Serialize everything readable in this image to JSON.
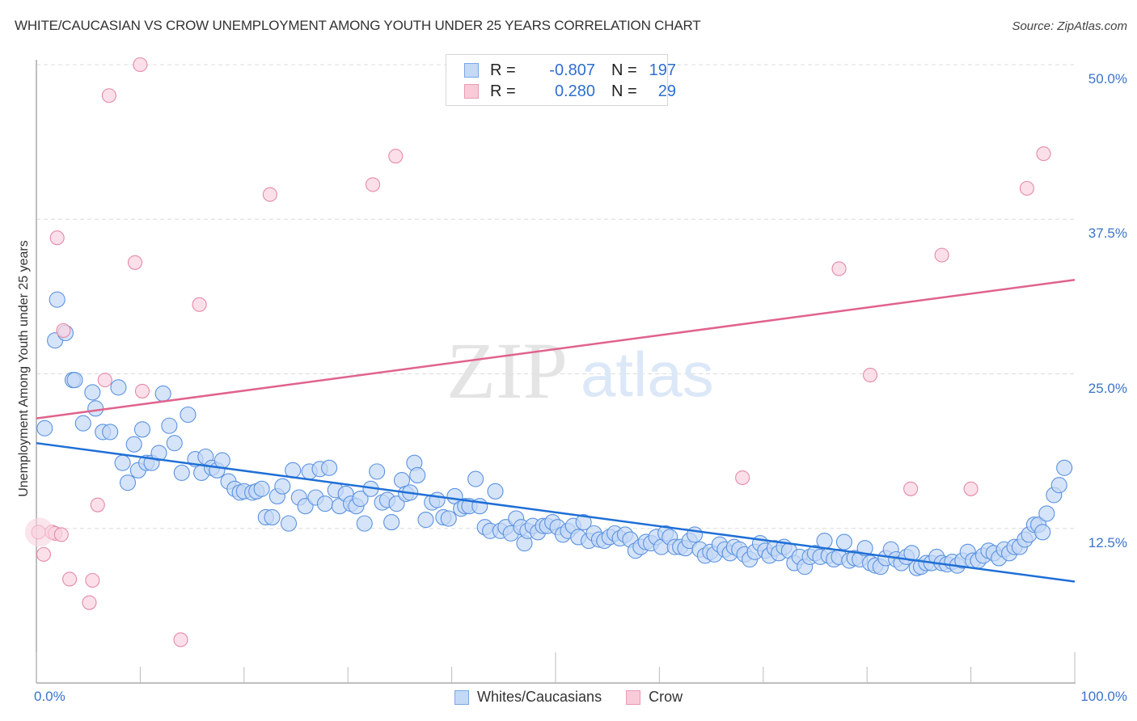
{
  "chart_data": {
    "type": "scatter",
    "title": "WHITE/CAUCASIAN VS CROW UNEMPLOYMENT AMONG YOUTH UNDER 25 YEARS CORRELATION CHART",
    "source": "Source: ZipAtlas.com",
    "xlabel": "",
    "ylabel": "Unemployment Among Youth under 25 years",
    "xlim": [
      0,
      100
    ],
    "ylim": [
      0,
      52
    ],
    "x_tick_labels": [
      "0.0%",
      "100.0%"
    ],
    "y_ticks": [
      12.5,
      25.0,
      37.5,
      50.0
    ],
    "y_tick_labels": [
      "12.5%",
      "25.0%",
      "37.5%",
      "50.0%"
    ],
    "grid": true,
    "watermark": {
      "part1": "ZIP",
      "part2": "atlas"
    },
    "legend": {
      "placement": "top-center",
      "rows": [
        {
          "r_label": "R =",
          "r_value": "-0.807",
          "n_label": "N =",
          "n_value": "197"
        },
        {
          "r_label": "R =",
          "r_value": " 0.280",
          "n_label": "N =",
          "n_value": " 29"
        }
      ]
    },
    "series": [
      {
        "name": "Whites/Caucasians",
        "color": "#5b93e0",
        "fill": "#c4d9f6",
        "line_color": "#1f6fd6",
        "trend": {
          "x": [
            0,
            100
          ],
          "y": [
            19.4,
            8.2
          ]
        },
        "points": [
          [
            0.8,
            20.6
          ],
          [
            2.0,
            31.0
          ],
          [
            1.8,
            27.7
          ],
          [
            2.8,
            28.3
          ],
          [
            3.5,
            24.5
          ],
          [
            3.7,
            24.5
          ],
          [
            4.5,
            21.0
          ],
          [
            5.4,
            23.5
          ],
          [
            5.7,
            22.2
          ],
          [
            6.4,
            20.3
          ],
          [
            7.1,
            20.3
          ],
          [
            7.9,
            23.9
          ],
          [
            8.3,
            17.8
          ],
          [
            8.8,
            16.2
          ],
          [
            9.4,
            19.3
          ],
          [
            9.8,
            17.2
          ],
          [
            10.2,
            20.5
          ],
          [
            10.6,
            17.8
          ],
          [
            11.1,
            17.8
          ],
          [
            11.8,
            18.6
          ],
          [
            12.2,
            23.4
          ],
          [
            12.8,
            20.8
          ],
          [
            13.3,
            19.4
          ],
          [
            14.0,
            17.0
          ],
          [
            14.6,
            21.7
          ],
          [
            15.3,
            18.1
          ],
          [
            15.9,
            17.0
          ],
          [
            16.3,
            18.3
          ],
          [
            16.9,
            17.4
          ],
          [
            17.4,
            17.2
          ],
          [
            17.9,
            18.0
          ],
          [
            18.5,
            16.3
          ],
          [
            19.1,
            15.7
          ],
          [
            19.6,
            15.4
          ],
          [
            20.0,
            15.5
          ],
          [
            20.8,
            15.4
          ],
          [
            21.2,
            15.5
          ],
          [
            21.7,
            15.7
          ],
          [
            22.1,
            13.4
          ],
          [
            22.7,
            13.4
          ],
          [
            23.2,
            15.1
          ],
          [
            23.7,
            15.9
          ],
          [
            24.3,
            12.9
          ],
          [
            24.7,
            17.2
          ],
          [
            25.3,
            15.0
          ],
          [
            25.9,
            14.3
          ],
          [
            26.3,
            17.1
          ],
          [
            26.9,
            15.0
          ],
          [
            27.3,
            17.3
          ],
          [
            27.8,
            14.5
          ],
          [
            28.2,
            17.4
          ],
          [
            28.8,
            15.6
          ],
          [
            29.2,
            14.3
          ],
          [
            29.8,
            15.3
          ],
          [
            30.3,
            14.5
          ],
          [
            30.8,
            14.3
          ],
          [
            31.2,
            14.9
          ],
          [
            31.6,
            12.9
          ],
          [
            32.2,
            15.7
          ],
          [
            32.8,
            17.1
          ],
          [
            33.3,
            14.6
          ],
          [
            33.8,
            14.8
          ],
          [
            34.2,
            13.0
          ],
          [
            34.7,
            14.5
          ],
          [
            35.2,
            16.4
          ],
          [
            35.6,
            15.3
          ],
          [
            36.0,
            15.4
          ],
          [
            36.4,
            17.8
          ],
          [
            36.7,
            16.8
          ],
          [
            37.5,
            13.2
          ],
          [
            38.1,
            14.6
          ],
          [
            38.6,
            14.8
          ],
          [
            39.2,
            13.4
          ],
          [
            39.7,
            13.3
          ],
          [
            40.3,
            15.1
          ],
          [
            40.9,
            14.1
          ],
          [
            41.3,
            14.3
          ],
          [
            41.7,
            14.3
          ],
          [
            42.3,
            16.5
          ],
          [
            42.7,
            14.3
          ],
          [
            43.2,
            12.6
          ],
          [
            43.7,
            12.3
          ],
          [
            44.2,
            15.5
          ],
          [
            44.7,
            12.3
          ],
          [
            45.2,
            12.6
          ],
          [
            45.7,
            12.1
          ],
          [
            46.2,
            13.3
          ],
          [
            46.7,
            12.6
          ],
          [
            47.0,
            11.3
          ],
          [
            47.3,
            12.3
          ],
          [
            47.8,
            12.7
          ],
          [
            48.3,
            12.2
          ],
          [
            48.8,
            12.7
          ],
          [
            49.2,
            12.7
          ],
          [
            49.7,
            13.0
          ],
          [
            50.2,
            12.6
          ],
          [
            50.7,
            12.0
          ],
          [
            51.2,
            12.3
          ],
          [
            51.7,
            12.7
          ],
          [
            52.2,
            11.8
          ],
          [
            52.7,
            13.0
          ],
          [
            53.2,
            11.5
          ],
          [
            53.7,
            12.1
          ],
          [
            54.2,
            11.6
          ],
          [
            54.7,
            11.5
          ],
          [
            55.2,
            11.8
          ],
          [
            55.7,
            12.1
          ],
          [
            56.2,
            11.7
          ],
          [
            56.7,
            12.0
          ],
          [
            57.2,
            11.6
          ],
          [
            57.7,
            10.7
          ],
          [
            58.2,
            11.0
          ],
          [
            58.7,
            11.4
          ],
          [
            59.2,
            11.3
          ],
          [
            59.7,
            11.8
          ],
          [
            60.2,
            11.0
          ],
          [
            60.6,
            12.1
          ],
          [
            61.0,
            11.8
          ],
          [
            61.5,
            11.0
          ],
          [
            62.0,
            11.0
          ],
          [
            62.5,
            10.9
          ],
          [
            62.9,
            11.5
          ],
          [
            63.4,
            12.0
          ],
          [
            63.9,
            10.8
          ],
          [
            64.4,
            10.3
          ],
          [
            64.9,
            10.6
          ],
          [
            65.3,
            10.4
          ],
          [
            65.8,
            11.2
          ],
          [
            66.3,
            10.8
          ],
          [
            66.8,
            10.5
          ],
          [
            67.2,
            11.0
          ],
          [
            67.7,
            10.8
          ],
          [
            68.2,
            10.4
          ],
          [
            68.7,
            10.0
          ],
          [
            69.2,
            10.6
          ],
          [
            69.7,
            11.3
          ],
          [
            70.2,
            10.7
          ],
          [
            70.6,
            10.3
          ],
          [
            71.1,
            10.9
          ],
          [
            71.5,
            10.5
          ],
          [
            72.0,
            11.0
          ],
          [
            72.5,
            10.7
          ],
          [
            73.0,
            9.7
          ],
          [
            73.5,
            10.2
          ],
          [
            74.0,
            9.4
          ],
          [
            74.5,
            10.2
          ],
          [
            75.0,
            10.5
          ],
          [
            75.5,
            10.2
          ],
          [
            75.9,
            11.5
          ],
          [
            76.3,
            10.3
          ],
          [
            76.8,
            10.0
          ],
          [
            77.3,
            10.2
          ],
          [
            77.8,
            11.4
          ],
          [
            78.3,
            9.9
          ],
          [
            78.8,
            10.1
          ],
          [
            79.3,
            10.0
          ],
          [
            79.8,
            10.9
          ],
          [
            80.3,
            9.7
          ],
          [
            80.8,
            9.5
          ],
          [
            81.3,
            9.4
          ],
          [
            81.8,
            10.1
          ],
          [
            82.3,
            10.8
          ],
          [
            82.8,
            10.0
          ],
          [
            83.3,
            9.7
          ],
          [
            83.8,
            10.2
          ],
          [
            84.3,
            10.5
          ],
          [
            84.8,
            9.3
          ],
          [
            85.2,
            9.4
          ],
          [
            85.7,
            9.7
          ],
          [
            86.2,
            9.7
          ],
          [
            86.7,
            10.2
          ],
          [
            87.2,
            9.7
          ],
          [
            87.7,
            9.6
          ],
          [
            88.2,
            9.8
          ],
          [
            88.7,
            9.5
          ],
          [
            89.2,
            9.9
          ],
          [
            89.7,
            10.6
          ],
          [
            90.2,
            9.9
          ],
          [
            90.7,
            9.9
          ],
          [
            91.2,
            10.3
          ],
          [
            91.7,
            10.7
          ],
          [
            92.2,
            10.5
          ],
          [
            92.7,
            10.1
          ],
          [
            93.2,
            10.8
          ],
          [
            93.7,
            10.5
          ],
          [
            94.2,
            11.0
          ],
          [
            94.7,
            11.0
          ],
          [
            95.2,
            11.6
          ],
          [
            95.6,
            12.0
          ],
          [
            96.1,
            12.8
          ],
          [
            96.5,
            12.8
          ],
          [
            96.9,
            12.2
          ],
          [
            97.3,
            13.7
          ],
          [
            98.0,
            15.2
          ],
          [
            98.5,
            16.0
          ],
          [
            99.0,
            17.4
          ]
        ]
      },
      {
        "name": "Crow",
        "color": "#e58aa6",
        "fill": "#f9d3df",
        "line_color": "#e0638d",
        "trend": {
          "x": [
            0,
            100
          ],
          "y": [
            21.4,
            32.6
          ]
        },
        "points": [
          [
            0.2,
            12.2
          ],
          [
            1.5,
            12.2
          ],
          [
            1.8,
            12.1
          ],
          [
            2.4,
            12.0
          ],
          [
            0.7,
            10.4
          ],
          [
            2.0,
            36.0
          ],
          [
            2.6,
            28.5
          ],
          [
            3.2,
            8.4
          ],
          [
            5.4,
            8.3
          ],
          [
            5.1,
            6.5
          ],
          [
            5.9,
            14.4
          ],
          [
            6.6,
            24.5
          ],
          [
            7.0,
            47.5
          ],
          [
            9.5,
            34.0
          ],
          [
            10.0,
            50.0
          ],
          [
            10.2,
            23.6
          ],
          [
            13.9,
            3.5
          ],
          [
            15.7,
            30.6
          ],
          [
            22.5,
            39.5
          ],
          [
            32.4,
            40.3
          ],
          [
            34.6,
            42.6
          ],
          [
            68.0,
            16.6
          ],
          [
            77.3,
            33.5
          ],
          [
            80.3,
            24.9
          ],
          [
            84.2,
            15.7
          ],
          [
            87.2,
            34.6
          ],
          [
            90.0,
            15.7
          ],
          [
            95.4,
            40.0
          ],
          [
            97.0,
            42.8
          ]
        ]
      }
    ]
  }
}
